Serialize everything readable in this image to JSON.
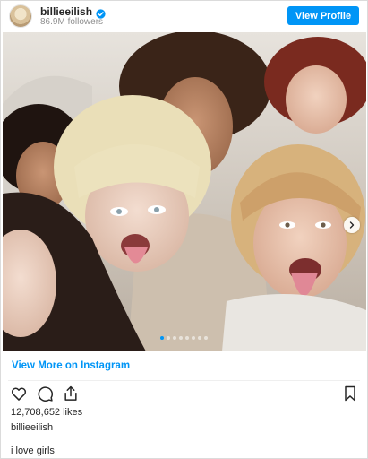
{
  "header": {
    "username": "billieeilish",
    "followers": "86.9M followers",
    "view_profile_label": "View Profile"
  },
  "post": {
    "image_alt": "Group of young women posing close together in a selfie, two sticking out their tongues",
    "carousel_dot_count": 8,
    "carousel_active_index": 0,
    "view_more_label": "View More on Instagram",
    "likes": "12,708,652 likes",
    "caption_user": "billieeilish",
    "caption_text": "i love girls"
  },
  "colors": {
    "accent": "#0095f6",
    "text": "#262626",
    "muted": "#8e8e8e",
    "border": "#dbdbdb"
  },
  "icons": [
    "verified-badge-icon",
    "heart-icon",
    "comment-icon",
    "share-icon",
    "bookmark-icon",
    "chevron-right-icon"
  ]
}
